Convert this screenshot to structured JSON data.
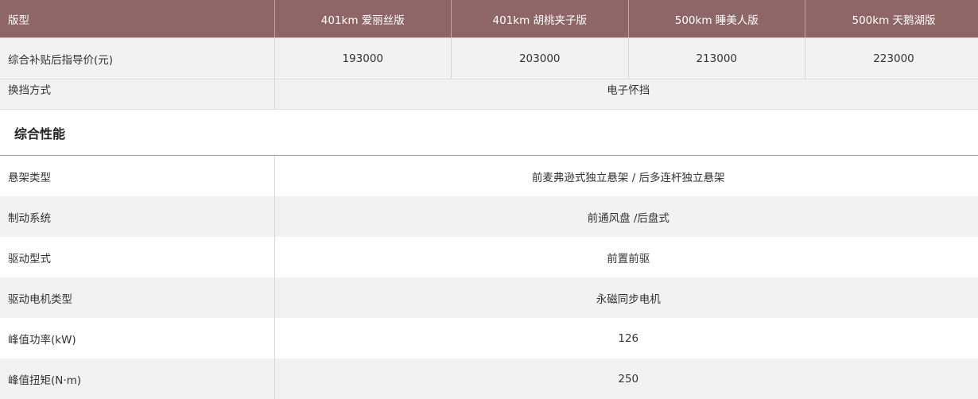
{
  "header": {
    "label": "版型",
    "models": [
      "401km 爱丽丝版",
      "401km 胡桃夹子版",
      "500km 睡美人版",
      "500km 天鹅湖版"
    ]
  },
  "price": {
    "label": "综合补贴后指导价(元)",
    "values": [
      "193000",
      "203000",
      "213000",
      "223000"
    ]
  },
  "gear": {
    "label": "换挡方式",
    "value": "电子怀挡"
  },
  "section": {
    "title": "综合性能"
  },
  "specs": [
    {
      "label": "悬架类型",
      "value": "前麦弗逊式独立悬架 / 后多连杆独立悬架"
    },
    {
      "label": "制动系统",
      "value": "前通风盘 /后盘式"
    },
    {
      "label": "驱动型式",
      "value": "前置前驱"
    },
    {
      "label": "驱动电机类型",
      "value": "永磁同步电机"
    },
    {
      "label": "峰值功率(kW)",
      "value": "126"
    },
    {
      "label": "峰值扭矩(N·m)",
      "value": "250"
    }
  ],
  "colors": {
    "header_bg": "#8e6666",
    "stripe_bg": "#f2f2f2"
  }
}
